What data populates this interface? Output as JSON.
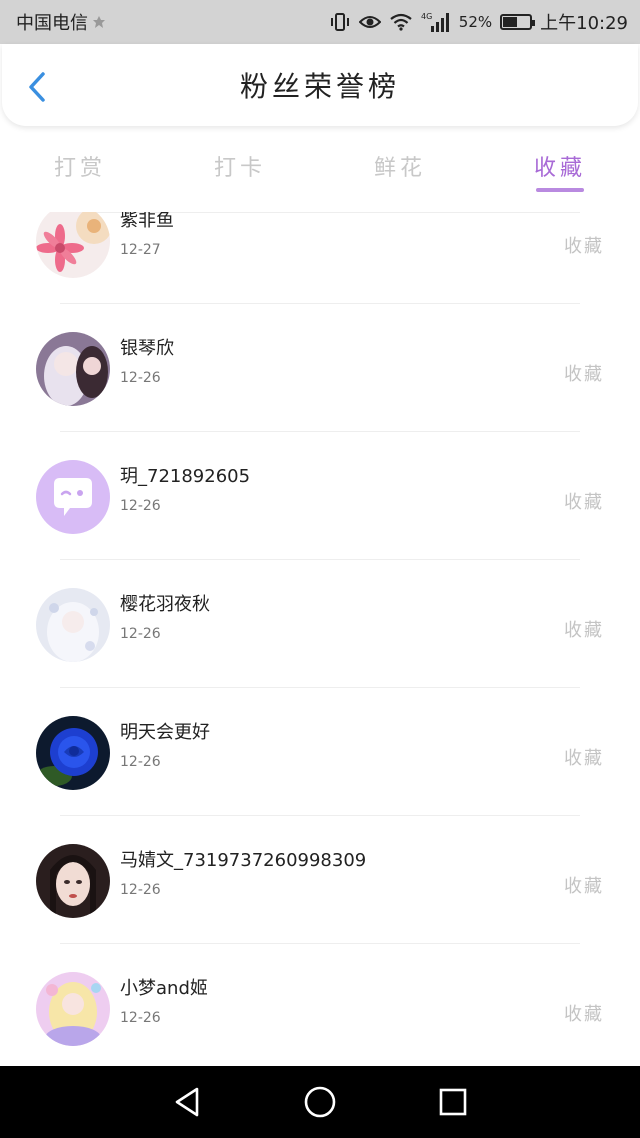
{
  "status_bar": {
    "carrier": "中国电信",
    "battery_percent": "52%",
    "battery_level": 0.52,
    "network": "4G",
    "time": "上午10:29",
    "icons": [
      "vibrate-icon",
      "eye-icon",
      "wifi-icon",
      "signal-icon",
      "battery-icon"
    ]
  },
  "header": {
    "title": "粉丝荣誉榜",
    "back_icon": "chevron-left-icon",
    "accent_color": "#3a8fe0"
  },
  "tabs": [
    {
      "label": "打赏",
      "active": false
    },
    {
      "label": "打卡",
      "active": false
    },
    {
      "label": "鲜花",
      "active": false
    },
    {
      "label": "收藏",
      "active": true
    }
  ],
  "active_tab_color": "#a86ad6",
  "fans": [
    {
      "name": "紫非鱼",
      "date": "12-27",
      "action": "收藏",
      "avatar_color": "#f3c6d0"
    },
    {
      "name": "银琴欣",
      "date": "12-26",
      "action": "收藏",
      "avatar_color": "#b9a8c8"
    },
    {
      "name": "玥_721892605",
      "date": "12-26",
      "action": "收藏",
      "avatar_color": "#d5b8f5"
    },
    {
      "name": "樱花羽夜秋",
      "date": "12-26",
      "action": "收藏",
      "avatar_color": "#dfe3ef"
    },
    {
      "name": "明天会更好",
      "date": "12-26",
      "action": "收藏",
      "avatar_color": "#1f3fc4"
    },
    {
      "name": "马婧文_7319737260998309",
      "date": "12-26",
      "action": "收藏",
      "avatar_color": "#4a3a3a"
    },
    {
      "name": "小梦and姬",
      "date": "12-26",
      "action": "收藏",
      "avatar_color": "#e9c9ef"
    }
  ],
  "nav_bar": {
    "buttons": [
      "back-triangle-icon",
      "home-circle-icon",
      "recents-square-icon"
    ]
  }
}
